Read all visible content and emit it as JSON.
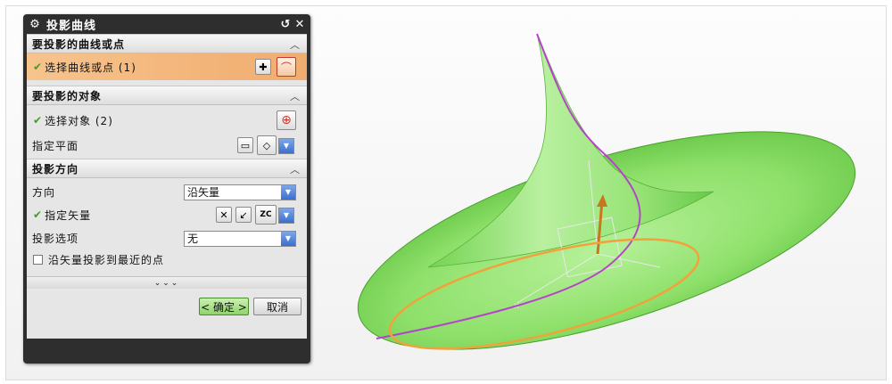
{
  "dialog": {
    "title": "投影曲线",
    "title_buttons": [
      "↺",
      "✕"
    ],
    "groups": {
      "curves": {
        "header": "要投影的曲线或点",
        "select_label": "选择曲线或点 (1)"
      },
      "target": {
        "header": "要投影的对象",
        "select_label": "选择对象 (2)",
        "plane_label": "指定平面"
      },
      "direction": {
        "header": "投影方向",
        "direction_label": "方向",
        "direction_value": "沿矢量",
        "vector_label": "指定矢量",
        "vector_icon_text": "ZC",
        "option_label": "投影选项",
        "option_value": "无",
        "checkbox_label": "沿矢量投影到最近的点"
      }
    },
    "more_label": "⌄⌄⌄",
    "ok_label": "< 确定 >",
    "cancel_label": "取消"
  },
  "colors": {
    "surface": "#8ee06a",
    "projected_curve": "#b545c8",
    "source_curve": "#f1a23a",
    "selection_highlight": "#f3b57a"
  }
}
